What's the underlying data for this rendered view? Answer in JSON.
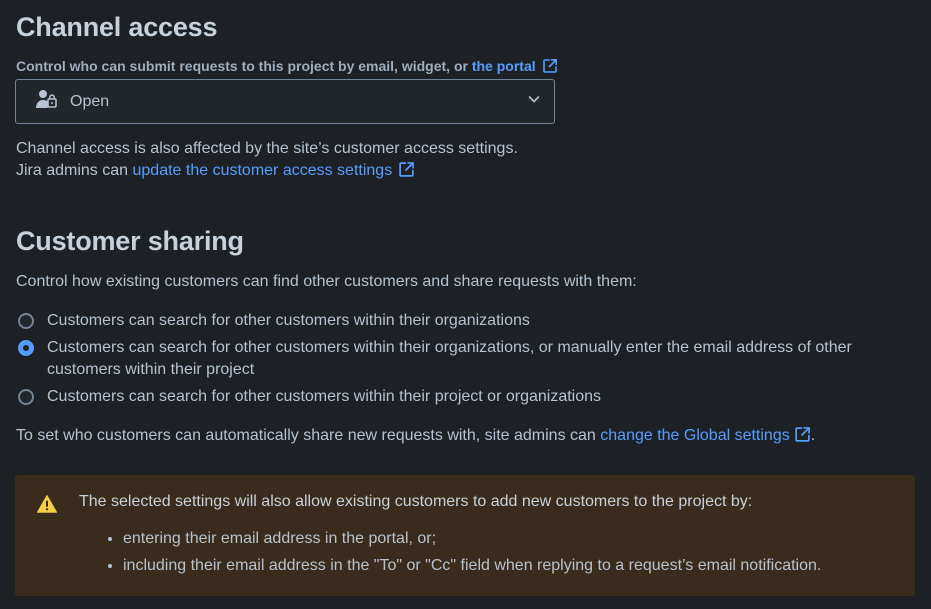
{
  "channel_access": {
    "title": "Channel access",
    "subtitle_prefix": "Control who can submit requests to this project by email, widget, or ",
    "subtitle_link": "the portal",
    "select": {
      "value": "Open",
      "icon": "person-lock-icon"
    },
    "note_line1": "Channel access is also affected by the site’s customer access settings.",
    "note_line2_prefix": "Jira admins can ",
    "note_line2_link": "update the customer access settings"
  },
  "customer_sharing": {
    "title": "Customer sharing",
    "description": "Control how existing customers can find other customers and share requests with them:",
    "options": [
      {
        "label": "Customers can search for other customers within their organizations",
        "checked": false
      },
      {
        "label": "Customers can search for other customers within their organizations, or manually enter the email address of other customers within their project",
        "checked": true
      },
      {
        "label": "Customers can search for other customers within their project or organizations",
        "checked": false
      }
    ],
    "global_note_prefix": "To set who customers can automatically share new requests with, site admins can ",
    "global_note_link": "change the Global settings",
    "global_note_suffix": "."
  },
  "warning": {
    "icon": "warning-icon",
    "text": "The selected settings will also allow existing customers to add new customers to the project by:",
    "items": [
      "entering their email address in the portal, or;",
      "including their email address in the \"To\" or \"Cc\" field when replying to a request’s email notification."
    ]
  },
  "colors": {
    "background": "#1d2125",
    "link": "#579dff",
    "warning_bg": "#3a2c1c",
    "warning_icon": "#f5cd47"
  }
}
